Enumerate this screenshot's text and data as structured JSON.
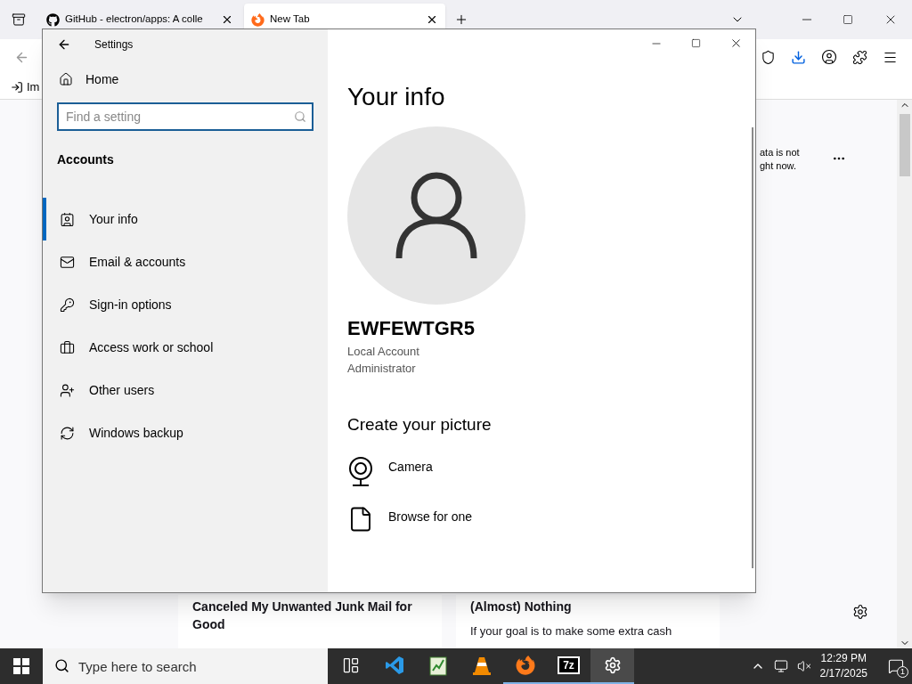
{
  "browser": {
    "tabs": [
      {
        "label": "GitHub - electron/apps: A colle",
        "selected": false,
        "kind": "github"
      },
      {
        "label": "New Tab",
        "selected": true,
        "kind": "firefox"
      }
    ],
    "bookmarks": [
      "Im"
    ],
    "notice_lines": [
      "ata is not",
      "ght now."
    ],
    "cards": [
      {
        "title": "Canceled My Unwanted Junk Mail for Good"
      },
      {
        "title": "(Almost) Nothing",
        "body": "If your goal is to make some extra cash"
      }
    ]
  },
  "settings": {
    "title": "Settings",
    "home": "Home",
    "search": {
      "placeholder": "Find a setting"
    },
    "section": "Accounts",
    "nav": [
      {
        "kind": "info",
        "label": "Your info",
        "selected": true
      },
      {
        "kind": "mail",
        "label": "Email & accounts",
        "selected": false
      },
      {
        "kind": "key",
        "label": "Sign-in options",
        "selected": false
      },
      {
        "kind": "work",
        "label": "Access work or school",
        "selected": false
      },
      {
        "kind": "users",
        "label": "Other users",
        "selected": false
      },
      {
        "kind": "backup",
        "label": "Windows backup",
        "selected": false
      }
    ],
    "heading": "Your info",
    "user_name": "EWFEWTGR5",
    "account_lines": [
      "Local Account",
      "Administrator"
    ],
    "picture_heading": "Create your picture",
    "picture_options": [
      {
        "kind": "camera",
        "label": "Camera"
      },
      {
        "kind": "browse",
        "label": "Browse for one"
      }
    ]
  },
  "taskbar": {
    "search": {
      "placeholder": "Type here to search"
    },
    "apps": [
      {
        "kind": "taskview",
        "running": false,
        "selected": false
      },
      {
        "kind": "vscode",
        "running": false,
        "selected": false
      },
      {
        "kind": "notepad",
        "running": false,
        "selected": false
      },
      {
        "kind": "vlc",
        "running": false,
        "selected": false
      },
      {
        "kind": "firefox",
        "running": true,
        "selected": false
      },
      {
        "kind": "sevenzip",
        "label": "7z",
        "running": true,
        "selected": false
      },
      {
        "kind": "settings",
        "running": true,
        "selected": true
      }
    ],
    "time": "12:29 PM",
    "date": "2/17/2025",
    "notifications": "1"
  }
}
